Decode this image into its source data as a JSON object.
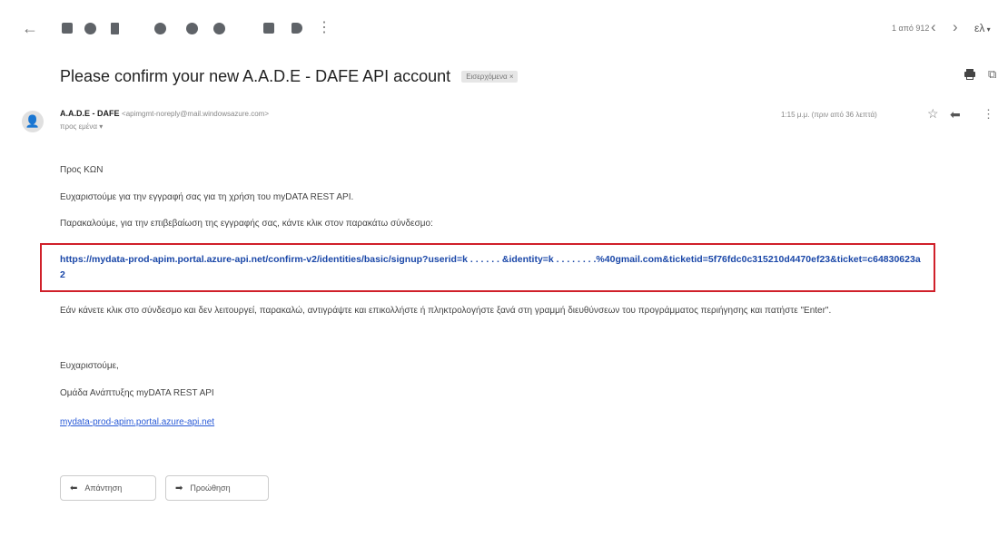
{
  "toolbar": {
    "pager": "1 από 912",
    "language": "ελ",
    "icons": [
      "back-arrow-icon",
      "archive-icon",
      "report-spam-icon",
      "delete-icon",
      "mark-unread-icon",
      "snooze-icon",
      "add-task-icon",
      "move-to-icon",
      "labels-icon",
      "more-icon"
    ]
  },
  "email": {
    "subject": "Please confirm your new A.A.D.E - DAFE API account",
    "label": "Εισερχόμενα ×",
    "sender_name": "A.A.D.E - DAFE",
    "sender_email": "<apimgmt-noreply@mail.windowsazure.com>",
    "to": "προς εμένα ▾",
    "time": "1:15 μ.μ. (πριν από 36 λεπτά)",
    "greeting": "Προς ΚΩΝ",
    "thanks_line": "Ευχαριστούμε για την εγγραφή σας για τη χρήση του myDATA REST API.",
    "instruction": "Παρακαλούμε, για την επιβεβαίωση της εγγραφής σας, κάντε κλικ στον παρακάτω σύνδεσμο:",
    "confirm_link": "https://mydata-prod-apim.portal.azure-api.net/confirm-v2/identities/basic/signup?userid=k . . . . . . &identity=k . . . . . . . .%40gmail.com&ticketid=5f76fdc0c315210d4470ef23&ticket=c64830623a2",
    "fallback": "Εάν κάνετε κλικ στο σύνδεσμο και δεν λειτουργεί, παρακαλώ, αντιγράψτε και επικολλήστε ή πληκτρολογήστε ξανά στη γραμμή διευθύνσεων του προγράμματος περιήγησης και πατήστε \"Enter\".",
    "closing": "Ευχαριστούμε,",
    "team": "Ομάδα Ανάπτυξης myDATA REST API",
    "site_link": "mydata-prod-apim.portal.azure-api.net"
  },
  "actions": {
    "reply": "Απάντηση",
    "forward": "Προώθηση"
  },
  "colors": {
    "link_box_border": "#d0202a",
    "link_color": "#1a47a8"
  }
}
